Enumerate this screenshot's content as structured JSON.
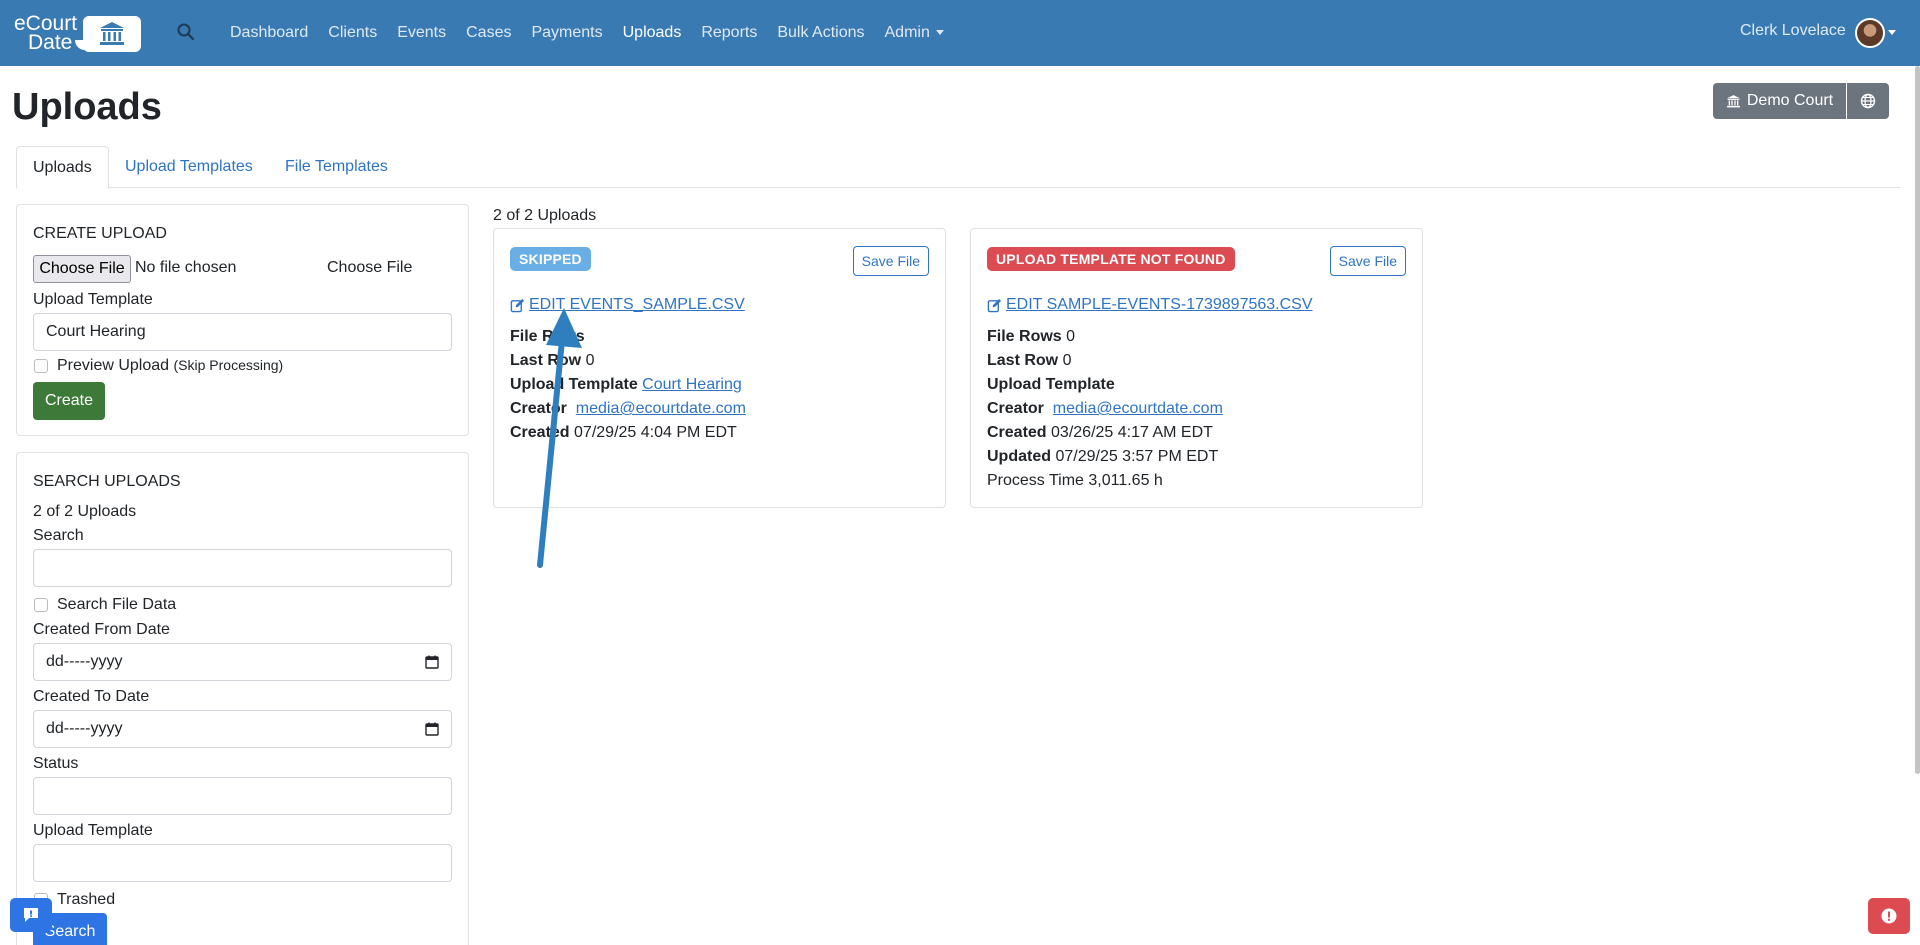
{
  "nav": {
    "logo_line1": "eCourt",
    "logo_line2": "Date",
    "links": [
      "Dashboard",
      "Clients",
      "Events",
      "Cases",
      "Payments",
      "Uploads",
      "Reports",
      "Bulk Actions",
      "Admin"
    ],
    "active": "Uploads",
    "user": "Clerk Lovelace"
  },
  "header": {
    "title": "Uploads",
    "court_button": "Demo Court"
  },
  "tabs": [
    "Uploads",
    "Upload Templates",
    "File Templates"
  ],
  "create_upload": {
    "heading": "CREATE UPLOAD",
    "file_button": "Choose File",
    "file_status": "No file chosen",
    "file_label": "Choose File",
    "template_label": "Upload Template",
    "template_value": "Court Hearing",
    "preview_label": "Preview Upload",
    "preview_note": "(Skip Processing)",
    "create_button": "Create"
  },
  "search_uploads": {
    "heading": "SEARCH UPLOADS",
    "count": "2 of 2 Uploads",
    "search_label": "Search",
    "search_file_data_label": "Search File Data",
    "from_label": "Created From Date",
    "from_placeholder": "dd-----yyyy",
    "to_label": "Created To Date",
    "to_placeholder": "dd-----yyyy",
    "status_label": "Status",
    "template_label": "Upload Template",
    "trashed_label": "Trashed",
    "search_button": "Search"
  },
  "results": {
    "count": "2 of 2 Uploads",
    "cards": [
      {
        "badge": "SKIPPED",
        "badge_color": "#6aaee6",
        "save_label": "Save File",
        "edit_label": "EDIT EVENTS_SAMPLE.CSV",
        "file_rows_label": "File Rows",
        "file_rows": "",
        "last_row_label": "Last Row",
        "last_row": "0",
        "template_label": "Upload Template",
        "template": "Court Hearing",
        "creator_label": "Creator",
        "creator": "media@ecourtdate.com",
        "created_label": "Created",
        "created": "07/29/25 4:04 PM EDT"
      },
      {
        "badge": "UPLOAD TEMPLATE NOT FOUND",
        "badge_color": "#dc4a52",
        "save_label": "Save File",
        "edit_label": "EDIT SAMPLE-EVENTS-1739897563.CSV",
        "file_rows_label": "File Rows",
        "file_rows": "0",
        "last_row_label": "Last Row",
        "last_row": "0",
        "template_label": "Upload Template",
        "creator_label": "Creator",
        "creator": "media@ecourtdate.com",
        "created_label": "Created",
        "created": "03/26/25 4:17 AM EDT",
        "updated_label": "Updated",
        "updated": "07/29/25 3:57 PM EDT",
        "process_time_label": "Process Time",
        "process_time": "3,011.65 h"
      }
    ]
  },
  "colors": {
    "navbar": "#3a7ab2",
    "link": "#2f74c4",
    "create": "#3d7a3a",
    "primary": "#2f74e4",
    "danger": "#dc4a52",
    "secondary": "#6c757d"
  },
  "icons": [
    "search-icon",
    "bank-icon",
    "globe-icon",
    "edit-icon",
    "calendar-icon",
    "chat-icon",
    "alert-icon"
  ]
}
